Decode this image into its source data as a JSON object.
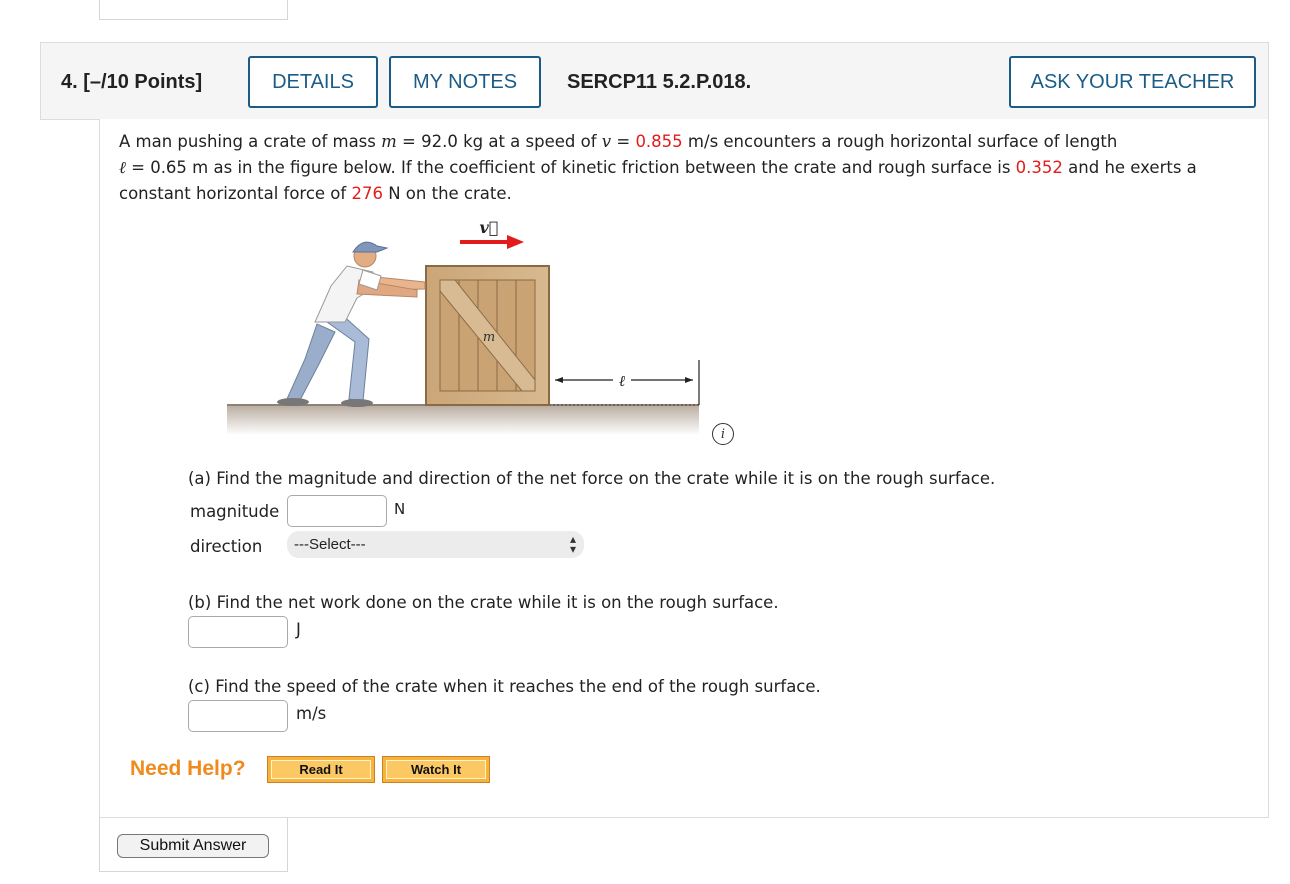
{
  "question": {
    "number": "4.",
    "points": "[–/10 Points]",
    "details_label": "DETAILS",
    "my_notes_label": "MY NOTES",
    "code": "SERCP11 5.2.P.018.",
    "ask_teacher_label": "ASK YOUR TEACHER"
  },
  "problem": {
    "t1": "A man pushing a crate of mass ",
    "m_sym": "m",
    "t2": " = 92.0 kg at a speed of ",
    "v_sym": "v",
    "t3": " = ",
    "v_val": "0.855",
    "t4": " m/s encounters a rough horizontal surface of length",
    "l_sym": "ℓ",
    "t5": " = 0.65 m as in the figure below. If the coefficient of kinetic friction between the crate and rough surface is ",
    "mu_val": "0.352",
    "t6": " and he exerts a constant horizontal force of ",
    "f_val": "276",
    "t7": " N on the crate."
  },
  "figure": {
    "v_label": "v⃗",
    "m_label": "m",
    "l_label": "ℓ",
    "info_label": "i"
  },
  "part_a": {
    "text": "(a) Find the magnitude and direction of the net force on the crate while it is on the rough surface.",
    "magnitude_label": "magnitude",
    "magnitude_value": "",
    "magnitude_unit": "N",
    "direction_label": "direction",
    "direction_selected": "---Select---"
  },
  "part_b": {
    "text": "(b) Find the net work done on the crate while it is on the rough surface.",
    "value": "",
    "unit": "J"
  },
  "part_c": {
    "text": "(c) Find the speed of the crate when it reaches the end of the rough surface.",
    "value": "",
    "unit": "m/s"
  },
  "help": {
    "need_help": "Need Help?",
    "read_it": "Read It",
    "watch_it": "Watch It"
  },
  "submit_label": "Submit Answer",
  "colors": {
    "accent_blue": "#1b5c87",
    "value_red": "#e21b1b",
    "help_orange": "#f08a1c"
  }
}
